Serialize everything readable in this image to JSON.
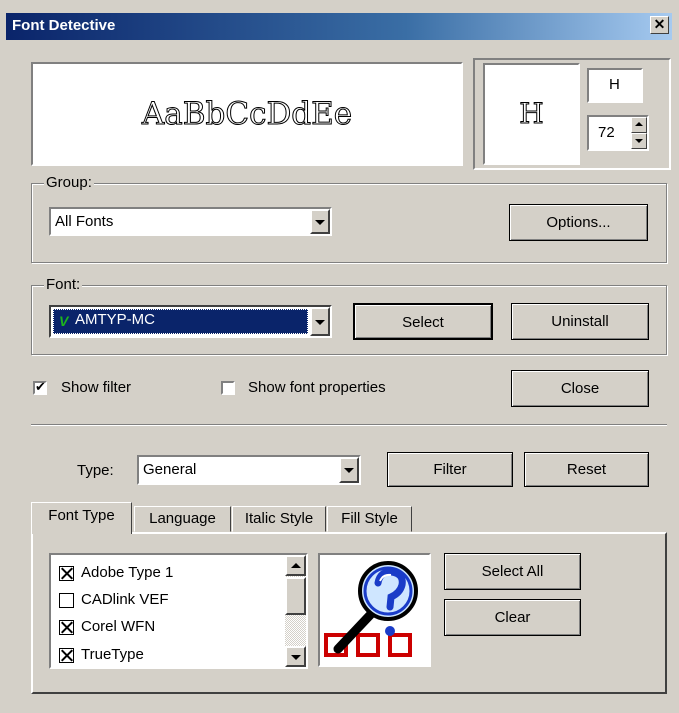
{
  "window": {
    "title": "Font Detective"
  },
  "preview": {
    "sample_text": "AaBbCcDdEe",
    "glyph": "H",
    "glyph_input": "H",
    "size": "72"
  },
  "group": {
    "label": "Group:",
    "selected": "All Fonts",
    "options_button": "Options..."
  },
  "font": {
    "label": "Font:",
    "selected": "AMTYP-MC",
    "font_mark": "V",
    "select_button": "Select",
    "uninstall_button": "Uninstall"
  },
  "filter_row": {
    "show_filter_label": "Show filter",
    "show_filter_checked": true,
    "show_props_label": "Show font properties",
    "show_props_checked": false,
    "close_button": "Close"
  },
  "type_row": {
    "label": "Type:",
    "selected": "General",
    "filter_button": "Filter",
    "reset_button": "Reset"
  },
  "tabs": [
    {
      "label": "Font Type",
      "active": true
    },
    {
      "label": "Language"
    },
    {
      "label": "Italic Style"
    },
    {
      "label": "Fill Style"
    }
  ],
  "font_types": [
    {
      "label": "Adobe Type 1",
      "checked": true
    },
    {
      "label": "CADlink VEF",
      "checked": false
    },
    {
      "label": "Corel WFN",
      "checked": true
    },
    {
      "label": "TrueType",
      "checked": true
    }
  ],
  "actions": {
    "select_all_button": "Select All",
    "clear_button": "Clear"
  },
  "colors": {
    "title_start": "#0a246a",
    "title_end": "#a6caf0",
    "face": "#d4d0c8",
    "selection": "#0a246a",
    "font_mark": "#1db41d",
    "logo_red": "#cc0000",
    "logo_blue": "#1a3cc8"
  }
}
